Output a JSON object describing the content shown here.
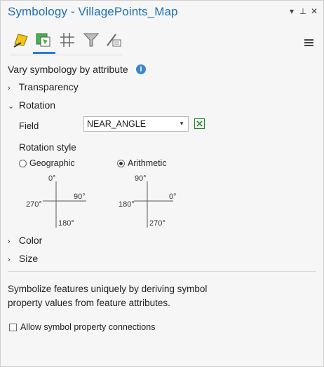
{
  "pane": {
    "title": "Symbology - VillagePoints_Map",
    "controls": {
      "dropdown": "▾",
      "pin": "⊥",
      "close": "✕"
    }
  },
  "tabs": [
    {
      "name": "primary-symbology-icon"
    },
    {
      "name": "vary-symbology-icon",
      "active": true
    },
    {
      "name": "symbol-layers-icon"
    },
    {
      "name": "symbol-classes-filter-icon"
    },
    {
      "name": "advanced-symbology-icon"
    }
  ],
  "main": {
    "heading": "Vary symbology by attribute",
    "info_glyph": "i",
    "transparency": "Transparency",
    "rotation": "Rotation",
    "field_label": "Field",
    "field_value": "NEAR_ANGLE",
    "rotation_style_label": "Rotation style",
    "geographic_label": "Geographic",
    "arithmetic_label": "Arithmetic",
    "selected_style": "Arithmetic",
    "geo_dial": {
      "top": "0°",
      "right": "90°",
      "bottom": "180°",
      "left": "270°"
    },
    "arith_dial": {
      "top": "90°",
      "right": "0°",
      "bottom": "270°",
      "left": "180°"
    },
    "color": "Color",
    "size": "Size",
    "description": "Symbolize features uniquely by deriving symbol property values from feature attributes.",
    "allow_connections_label": "Allow symbol property connections",
    "allow_connections_checked": false
  },
  "colors": {
    "title": "#1d6fb8",
    "accent": "#2b7bd1",
    "info": "#3a86d0"
  }
}
